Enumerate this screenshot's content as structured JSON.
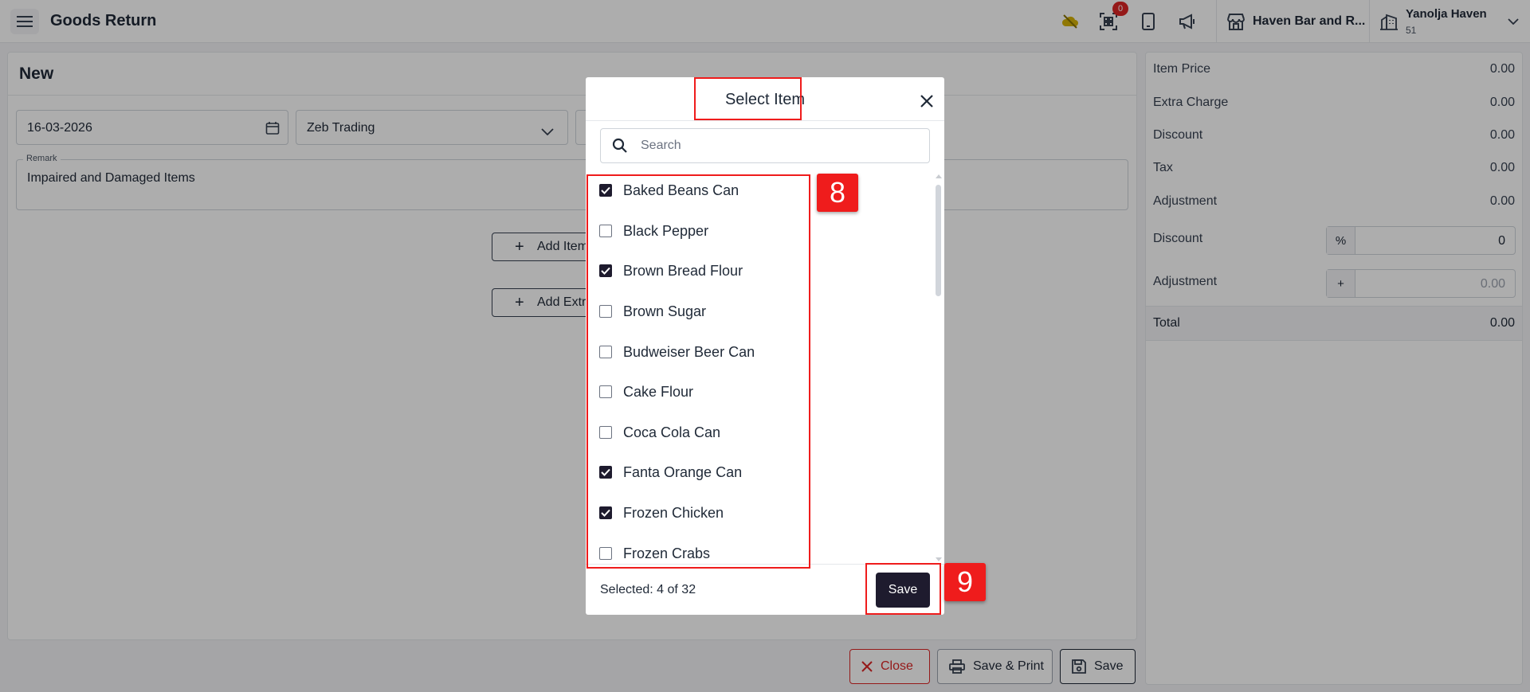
{
  "header": {
    "title": "Goods Return",
    "notification_count": "0",
    "store_name": "Haven Bar and R...",
    "user_name": "Yanolja Haven",
    "user_sub": "51"
  },
  "form": {
    "title": "New",
    "date": "16-03-2026",
    "supplier": "Zeb Trading",
    "remark_label": "Remark",
    "remark_value": "Impaired and Damaged Items",
    "add_item_label": "Add Item",
    "add_extra_label": "Add Extra Charge"
  },
  "summary": {
    "item_price_label": "Item Price",
    "item_price": "0.00",
    "extra_charge_label": "Extra Charge",
    "extra_charge": "0.00",
    "discount_label": "Discount",
    "discount": "0.00",
    "tax_label": "Tax",
    "tax": "0.00",
    "adjustment_label": "Adjustment",
    "adjustment": "0.00",
    "discount_input_label": "Discount",
    "discount_prefix": "%",
    "discount_input_value": "0",
    "adjustment_input_label": "Adjustment",
    "adjustment_prefix": "+",
    "adjustment_input_placeholder": "0.00",
    "total_label": "Total",
    "total": "0.00"
  },
  "actions": {
    "close_label": "Close",
    "save_print_label": "Save & Print",
    "save_label": "Save"
  },
  "modal": {
    "title": "Select Item",
    "search_placeholder": "Search",
    "items": [
      {
        "label": "Baked Beans Can",
        "checked": true
      },
      {
        "label": "Black Pepper",
        "checked": false
      },
      {
        "label": "Brown Bread Flour",
        "checked": true
      },
      {
        "label": "Brown Sugar",
        "checked": false
      },
      {
        "label": "Budweiser Beer Can",
        "checked": false
      },
      {
        "label": "Cake Flour",
        "checked": false
      },
      {
        "label": "Coca Cola Can",
        "checked": false
      },
      {
        "label": "Fanta Orange Can",
        "checked": true
      },
      {
        "label": "Frozen Chicken",
        "checked": true
      },
      {
        "label": "Frozen Crabs",
        "checked": false
      }
    ],
    "selected_text": "Selected: 4 of 32",
    "save_label": "Save"
  },
  "annotations": {
    "items_tag": "8",
    "save_tag": "9"
  },
  "colors": {
    "accent_dark": "#1e1b2e",
    "annotation_red": "#ef1c1c",
    "badge_red": "#dc2626",
    "close_red": "#dc2626",
    "cloud_icon_yellow": "#d4b106"
  }
}
